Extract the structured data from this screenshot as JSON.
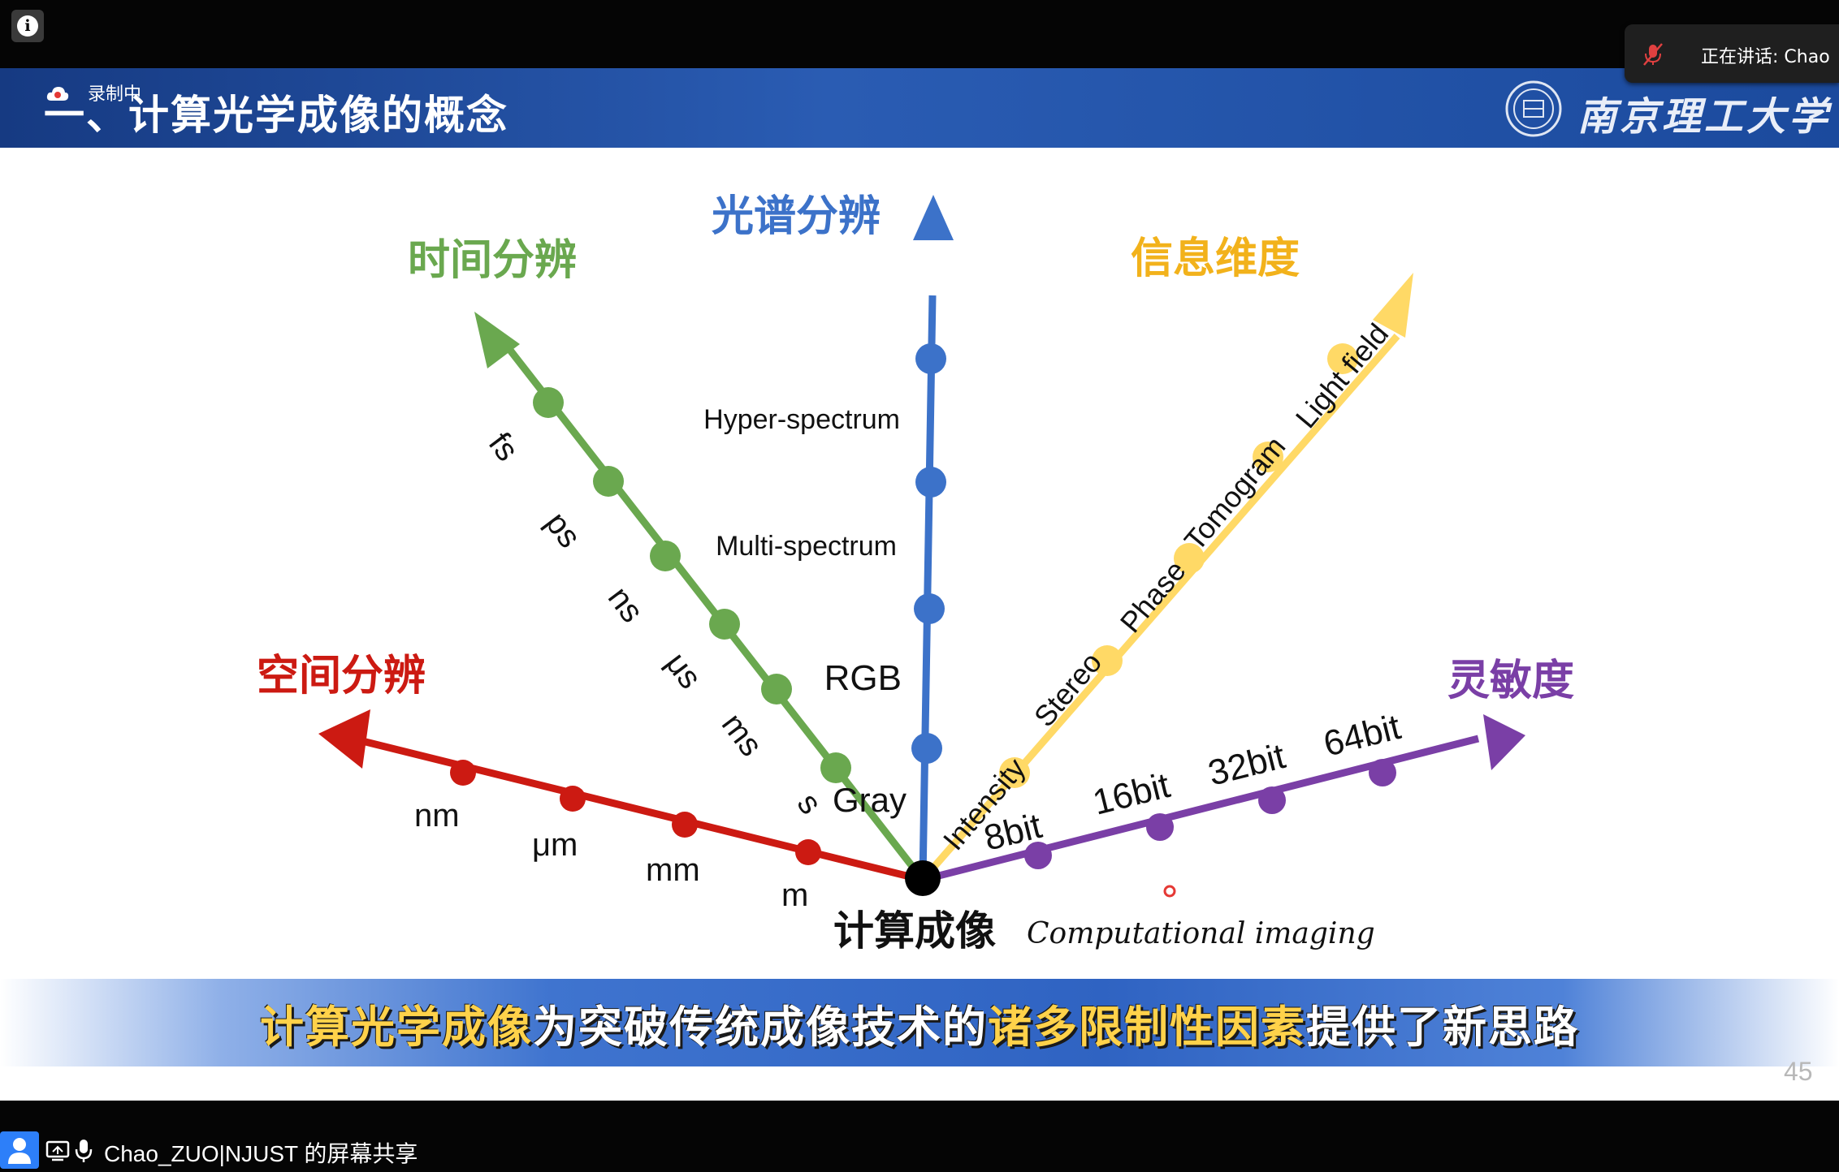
{
  "meeting": {
    "info_icon": "info-icon",
    "speaker_label": "正在讲话: Chao",
    "recording_label": "录制中",
    "share_label": "Chao_ZUO|NJUST 的屏幕共享"
  },
  "slide": {
    "title": "一、计算光学成像的概念",
    "logo_text": "南京理工大学",
    "page_number": "45",
    "center_label": "计算成像",
    "center_label_en": "Computational imaging",
    "axes": [
      {
        "id": "spatial",
        "title": "空间分辨",
        "color": "#cc1a12",
        "ticks": [
          "m",
          "mm",
          "μm",
          "nm"
        ]
      },
      {
        "id": "temporal",
        "title": "时间分辨",
        "color": "#6aa84f",
        "ticks": [
          "s",
          "ms",
          "μs",
          "ns",
          "ps",
          "fs"
        ]
      },
      {
        "id": "spectral",
        "title": "光谱分辨",
        "color": "#3c72c9",
        "ticks": [
          "Gray",
          "RGB",
          "Multi-spectrum",
          "Hyper-spectrum"
        ]
      },
      {
        "id": "info",
        "title": "信息维度",
        "color": "#ffd966",
        "title_color": "#f2b21b",
        "ticks": [
          "Intensity",
          "Stereo",
          "Phase",
          "Tomogram",
          "Light field"
        ]
      },
      {
        "id": "sensitivity",
        "title": "灵敏度",
        "color": "#7a3fa6",
        "ticks": [
          "8bit",
          "16bit",
          "32bit",
          "64bit"
        ]
      }
    ],
    "banner": {
      "part1": "计算光学成像",
      "part2": "为突破传统成像技术的",
      "part3": "诸多限制性因素",
      "part4": "提供了新思路"
    }
  }
}
